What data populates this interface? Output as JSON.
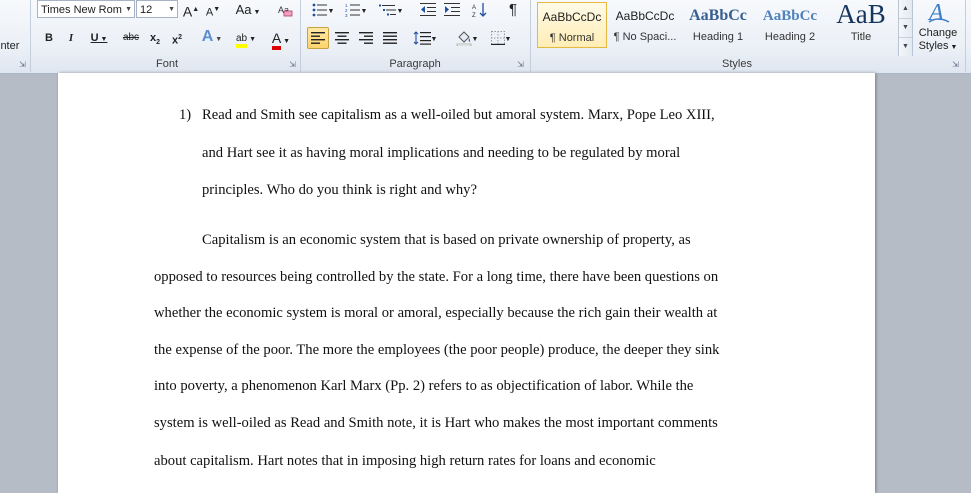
{
  "ribbon": {
    "clipboard_partial_label": "inter",
    "font": {
      "family": "Times New Rom",
      "size": "12",
      "grow_glyph": "A",
      "shrink_glyph": "A",
      "change_case_glyph": "Aa",
      "bold": "B",
      "italic": "I",
      "underline": "U",
      "strike": "abc",
      "subscript": "x",
      "superscript": "x",
      "effects_glyph": "A",
      "highlight_glyph": "ab",
      "font_color_glyph": "A",
      "group_label": "Font"
    },
    "paragraph": {
      "group_label": "Paragraph"
    },
    "styles": {
      "tiles": [
        {
          "sample": "AaBbCcDc",
          "name": "¶ Normal"
        },
        {
          "sample": "AaBbCcDc",
          "name": "¶ No Spaci..."
        },
        {
          "sample": "AaBbCc",
          "name": "Heading 1"
        },
        {
          "sample": "AaBbCc",
          "name": "Heading 2"
        },
        {
          "sample": "AaB",
          "name": "Title"
        }
      ],
      "change_styles_line1": "Change",
      "change_styles_line2": "Styles",
      "group_label": "Styles"
    }
  },
  "document": {
    "question_number": "1)",
    "question_lines": [
      "Read and Smith see capitalism as a well-oiled but amoral system. Marx, Pope Leo XIII,",
      "and Hart see it as having moral implications  and needing to be regulated by moral",
      "principles.  Who do you think is right and why?"
    ],
    "answer_lines": [
      "Capitalism is an economic system that is based on private ownership of property, as",
      "opposed to resources being controlled by the state. For a long time, there have been questions on",
      "whether the economic system is moral  or amoral,  especially because the rich gain their wealth at",
      "the expense of the poor. The more the employees (the poor people) produce, the deeper they sink",
      "into poverty, a phenomenon Karl Marx (Pp. 2) refers to as objectification of labor. While the",
      "system is well-oiled as Read and Smith note, it is Hart who makes the most important  comments",
      "about capitalism.  Hart notes that in imposing  high return rates  for loans  and economic"
    ]
  }
}
